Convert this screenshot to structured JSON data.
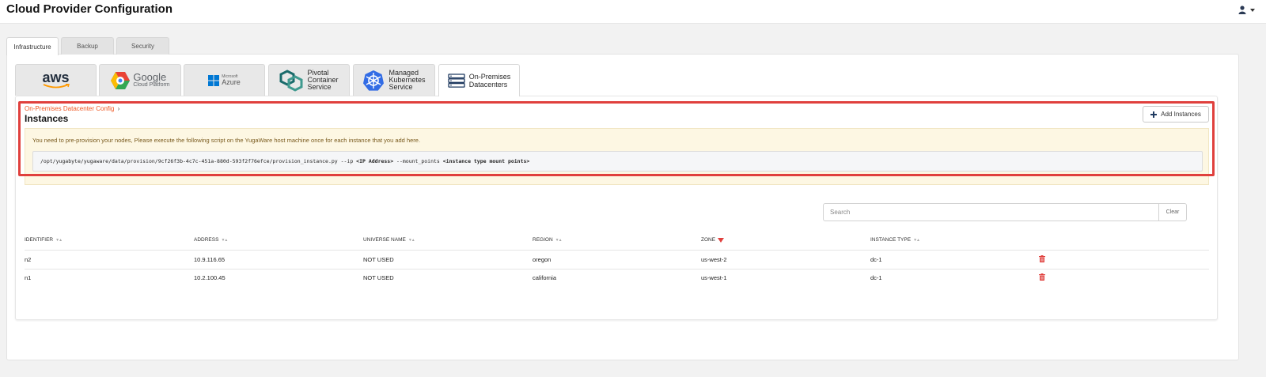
{
  "header": {
    "title": "Cloud Provider Configuration"
  },
  "tabs": [
    {
      "label": "Infrastructure",
      "active": true
    },
    {
      "label": "Backup",
      "active": false
    },
    {
      "label": "Security",
      "active": false
    }
  ],
  "providers": {
    "aws": {
      "label": "aws"
    },
    "gcp": {
      "line1": "Google",
      "line2": "Cloud Platform"
    },
    "azure": {
      "line1": "Microsoft",
      "line2": "Azure"
    },
    "pivotal": {
      "line1": "Pivotal",
      "line2": "Container",
      "line3": "Service"
    },
    "k8s": {
      "line1": "Managed",
      "line2": "Kubernetes",
      "line3": "Service"
    },
    "onprem": {
      "line1": "On-Premises",
      "line2": "Datacenters",
      "active": true
    }
  },
  "instances": {
    "breadcrumb": "On-Premises Datacenter Config",
    "title": "Instances",
    "add_button": "Add Instances",
    "notice": "You need to pre-provision your nodes, Please execute the following script on the YugaWare host machine once for each instance that you add here.",
    "cmd": {
      "path": "/opt/yugabyte/yugaware/data/provision/9cf26f3b-4c7c-451a-880d-593f2f76efce/provision_instance.py --ip ",
      "ip_arg": "<IP Address>",
      "mount": " --mount_points ",
      "mount_arg": "<instance type mount points>"
    },
    "search": {
      "placeholder": "Search",
      "clear": "Clear"
    },
    "columns": {
      "identifier": "IDENTIFIER",
      "address": "ADDRESS",
      "universe": "UNIVERSE NAME",
      "region": "REGION",
      "zone": "ZONE",
      "instance_type": "INSTANCE TYPE"
    },
    "rows": [
      {
        "identifier": "n2",
        "address": "10.9.116.65",
        "universe": "NOT USED",
        "region": "oregon",
        "zone": "us-west-2",
        "instance_type": "dc-1"
      },
      {
        "identifier": "n1",
        "address": "10.2.100.45",
        "universe": "NOT USED",
        "region": "california",
        "zone": "us-west-1",
        "instance_type": "dc-1"
      }
    ]
  },
  "colors": {
    "accent": "#ef5824",
    "highlight": "#e0403d",
    "notice_bg": "#fdf7e3"
  },
  "icons": [
    "user-icon",
    "aws-logo",
    "google-cloud-logo",
    "azure-logo",
    "pivotal-logo",
    "kubernetes-icon",
    "server-rack-icon",
    "plus-icon",
    "trash-icon",
    "sort-icon",
    "sort-desc-icon"
  ]
}
